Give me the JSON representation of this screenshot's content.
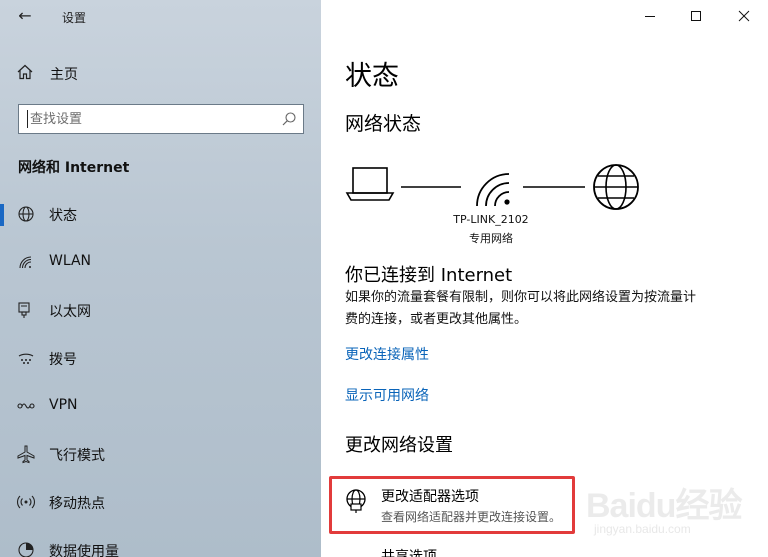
{
  "window": {
    "title": "设置",
    "back_glyph": "←",
    "controls": {
      "minimize": "—",
      "maximize": "☐",
      "close": "✕"
    }
  },
  "sidebar": {
    "home_label": "主页",
    "search_placeholder": "查找设置",
    "section_title": "网络和 Internet",
    "items": [
      {
        "label": "状态",
        "icon": "globe-icon",
        "active": true
      },
      {
        "label": "WLAN",
        "icon": "wifi-icon"
      },
      {
        "label": "以太网",
        "icon": "ethernet-icon"
      },
      {
        "label": "拨号",
        "icon": "dialup-icon"
      },
      {
        "label": "VPN",
        "icon": "vpn-icon"
      },
      {
        "label": "飞行模式",
        "icon": "airplane-icon"
      },
      {
        "label": "移动热点",
        "icon": "hotspot-icon"
      },
      {
        "label": "数据使用量",
        "icon": "data-usage-icon"
      }
    ]
  },
  "main": {
    "page_title": "状态",
    "network_status_title": "网络状态",
    "network_name": "TP-LINK_2102",
    "network_type": "专用网络",
    "connected_title": "你已连接到 Internet",
    "connected_desc_line1": "如果你的流量套餐有限制，则你可以将此网络设置为按流量计",
    "connected_desc_line2": "费的连接，或者更改其他属性。",
    "link_change_properties": "更改连接属性",
    "link_show_networks": "显示可用网络",
    "change_settings_title": "更改网络设置",
    "adapter_title": "更改适配器选项",
    "adapter_desc": "查看网络适配器并更改连接设置。",
    "next_item_title": "共享选项"
  },
  "watermark": {
    "brand": "Baidu经验",
    "url": "jingyan.baidu.com"
  },
  "colors": {
    "accent": "#1a68c4",
    "link": "#0a64b9",
    "highlight": "#e23b3b",
    "sidebar_bg": "#b9c6d2"
  }
}
